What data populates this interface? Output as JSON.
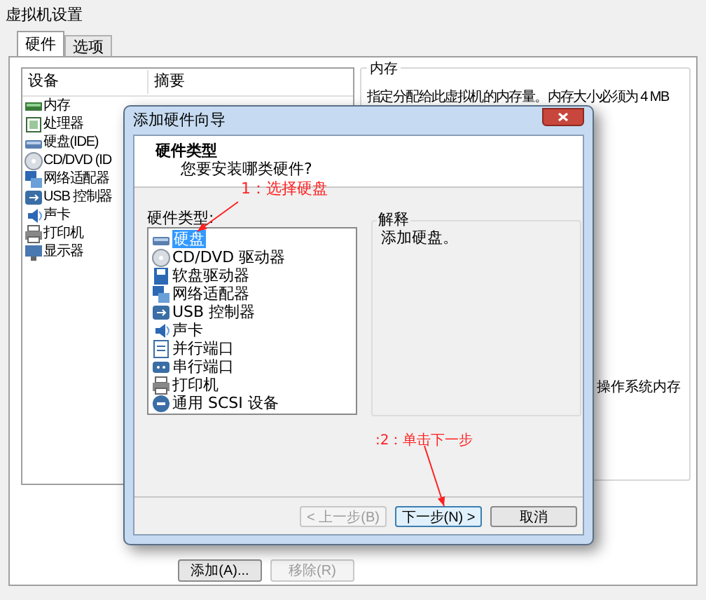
{
  "window": {
    "title": "虚拟机设置"
  },
  "tabs": [
    {
      "label": "硬件",
      "selected": true
    },
    {
      "label": "选项",
      "selected": false
    }
  ],
  "devices": {
    "columns": [
      "设备",
      "摘要"
    ],
    "rows": [
      {
        "kind": "memory",
        "name": "内存"
      },
      {
        "kind": "cpu",
        "name": "处理器"
      },
      {
        "kind": "disk",
        "name": "硬盘(IDE)"
      },
      {
        "kind": "cd",
        "name": "CD/DVD (ID"
      },
      {
        "kind": "network",
        "name": "网络适配器"
      },
      {
        "kind": "usb",
        "name": "USB 控制器"
      },
      {
        "kind": "sound",
        "name": "声卡"
      },
      {
        "kind": "printer",
        "name": "打印机"
      },
      {
        "kind": "display",
        "name": "显示器"
      }
    ]
  },
  "buttons": [
    {
      "label": "添加(A)...",
      "disabled": false
    },
    {
      "label": "移除(R)",
      "disabled": true
    }
  ],
  "memory_group": {
    "title": "内存",
    "description": "指定分配给此虚拟机的内存量。内存大小必须为 4 MB",
    "label": "操作系统内存"
  },
  "dialog": {
    "title": "添加硬件向导",
    "heading": "硬件类型",
    "subheading": "您要安装哪类硬件?",
    "list_label": "硬件类型:",
    "items": [
      {
        "kind": "disk",
        "label": "硬盘",
        "selected": true
      },
      {
        "kind": "cd",
        "label": "CD/DVD 驱动器",
        "selected": false
      },
      {
        "kind": "floppy",
        "label": "软盘驱动器",
        "selected": false
      },
      {
        "kind": "network",
        "label": "网络适配器",
        "selected": false
      },
      {
        "kind": "usb",
        "label": "USB 控制器",
        "selected": false
      },
      {
        "kind": "sound",
        "label": "声卡",
        "selected": false
      },
      {
        "kind": "parallel",
        "label": "并行端口",
        "selected": false
      },
      {
        "kind": "serial",
        "label": "串行端口",
        "selected": false
      },
      {
        "kind": "printer",
        "label": "打印机",
        "selected": false
      },
      {
        "kind": "scsi",
        "label": "通用 SCSI 设备",
        "selected": false
      }
    ],
    "explanation": {
      "title": "解释",
      "text": "添加硬盘。"
    },
    "buttons": [
      {
        "label": "< 上一步(B)",
        "disabled": true,
        "default": false
      },
      {
        "label": "下一步(N) >",
        "disabled": false,
        "default": true
      },
      {
        "label": "取消",
        "disabled": false,
        "default": false
      }
    ]
  },
  "annotations": [
    {
      "text": "1：选择硬盘"
    },
    {
      "text": ":2：单击下一步"
    }
  ]
}
